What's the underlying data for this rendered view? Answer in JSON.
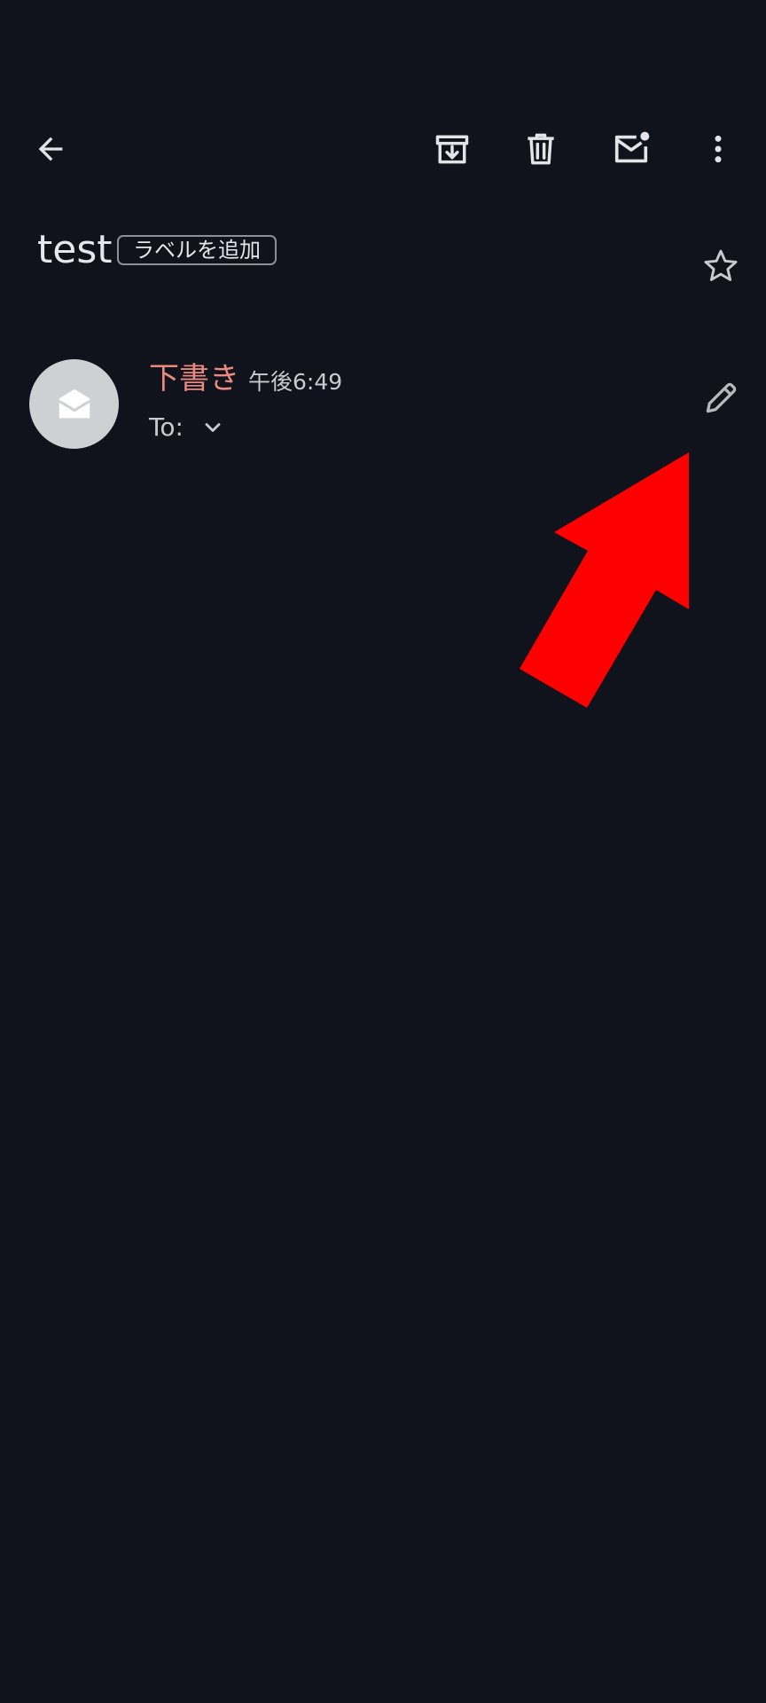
{
  "toolbar": {
    "back_icon": "arrow-back-icon",
    "archive_icon": "archive-icon",
    "delete_icon": "trash-icon",
    "mark_unread_icon": "mail-unread-icon",
    "more_icon": "more-vert-icon"
  },
  "message": {
    "subject": "test",
    "add_label": "ラベルを追加",
    "star_icon": "star-outline-icon"
  },
  "draft": {
    "label": "下書き",
    "time": "午後6:49",
    "to_label": "To:",
    "avatar_icon": "open-envelope-icon",
    "expand_icon": "chevron-down-icon",
    "edit_icon": "pencil-icon"
  },
  "annotation": {
    "arrow_color": "#ff0000",
    "arrow_icon": "red-arrow-annotation"
  },
  "colors": {
    "background": "#11131c",
    "draft_accent": "#ea8a7e",
    "icon": "#e3e3e8"
  }
}
